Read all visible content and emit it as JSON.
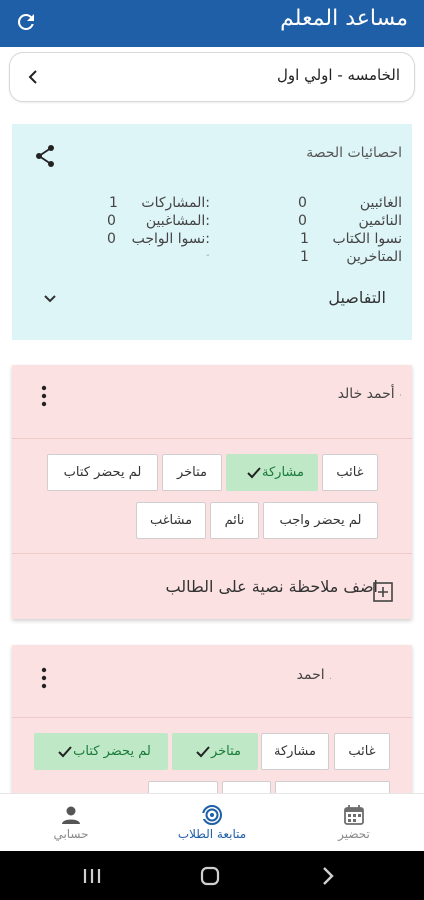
{
  "app": {
    "title": "مساعد المعلم"
  },
  "class_selector": {
    "value": "الخامسه - اولي اول"
  },
  "stats": {
    "title": "احصائيات الحصة",
    "rows": [
      {
        "label": "الغائبين",
        "value": "0"
      },
      {
        "label": "النائمين",
        "value": "0"
      },
      {
        "label": "نسوا الكتاب",
        "value": "1"
      },
      {
        "label": "المتاخرين",
        "value": "1"
      },
      {
        "label": "المشاركات:",
        "value": "1"
      },
      {
        "label": "المشاغبين:",
        "value": "0"
      },
      {
        "label": "نسوا الواجب:",
        "value": "0"
      },
      {
        "label": "",
        "value": "-"
      }
    ],
    "details_label": "التفاصيل"
  },
  "students": [
    {
      "name": "أحمد خالد",
      "suffix": "·",
      "chips": [
        {
          "label": "غائب",
          "selected": false
        },
        {
          "label": "مشاركة",
          "selected": true
        },
        {
          "label": "متاخر",
          "selected": false
        },
        {
          "label": "لم يحضر كتاب",
          "selected": false
        },
        {
          "label": "لم يحضر واجب",
          "selected": false
        },
        {
          "label": "نائم",
          "selected": false
        },
        {
          "label": "مشاغب",
          "selected": false
        }
      ],
      "note_label": "اضف ملاحظة نصية على الطالب"
    },
    {
      "name": "احمد",
      "suffix": ".",
      "chips": [
        {
          "label": "غائب",
          "selected": false
        },
        {
          "label": "مشاركة",
          "selected": false
        },
        {
          "label": "متاخر",
          "selected": true
        },
        {
          "label": "لم يحضر كتاب",
          "selected": true
        }
      ]
    }
  ],
  "bottom_nav": [
    {
      "label": "تحضير",
      "icon": "calendar-icon",
      "active": false
    },
    {
      "label": "متابعة الطلاب",
      "icon": "tracking-icon",
      "active": true
    },
    {
      "label": "حسابي",
      "icon": "person-icon",
      "active": false
    }
  ],
  "system_nav": {
    "icons": [
      "recents-icon",
      "home-icon",
      "back-icon"
    ]
  },
  "colors": {
    "primary": "#1f5fa8",
    "stats_bg": "#def5f8",
    "card_bg": "#fbe1e1",
    "chip_selected": "#bfe8c6",
    "chip_selected_text": "#1a7a3a"
  }
}
